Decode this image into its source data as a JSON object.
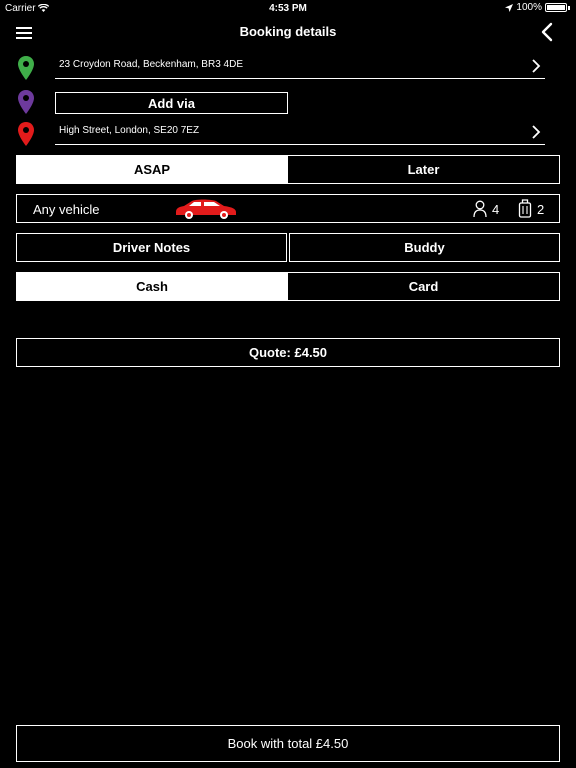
{
  "status": {
    "carrier": "Carrier",
    "time": "4:53 PM",
    "battery": "100%"
  },
  "nav": {
    "title": "Booking details",
    "menu_icon": "hamburger-menu-icon",
    "back_icon": "chevron-left-icon"
  },
  "pickup": {
    "address": "23 Croydon Road, Beckenham, BR3 4DE",
    "pin_color": "#3fae49"
  },
  "via": {
    "label": "Add via",
    "pin_color": "#6d3a9c"
  },
  "dropoff": {
    "address": "High Street, London, SE20 7EZ",
    "pin_color": "#e21b1b"
  },
  "timing": {
    "asap": "ASAP",
    "later": "Later",
    "selected": "ASAP"
  },
  "vehicle": {
    "label": "Any vehicle",
    "passengers": "4",
    "luggage": "2",
    "car_color": "#e21b1b"
  },
  "options": {
    "notes": "Driver Notes",
    "buddy": "Buddy"
  },
  "payment": {
    "cash": "Cash",
    "card": "Card",
    "selected": "Cash"
  },
  "quote": {
    "label": "Quote: £4.50"
  },
  "book": {
    "label": "Book with total £4.50"
  }
}
